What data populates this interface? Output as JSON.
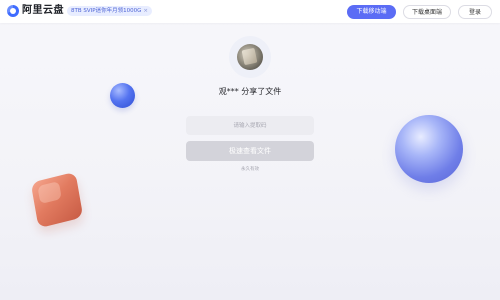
{
  "header": {
    "brand": "阿里云盘",
    "promo": "8TB SVIP迷你年月领1000G",
    "promo_close": "×",
    "download_mobile": "下载移动端",
    "download_desktop": "下载桌面端",
    "login": "登录"
  },
  "share": {
    "title": "观*** 分享了文件",
    "code_placeholder": "请输入提取码",
    "view_button": "极速查看文件",
    "expiry": "永久有效"
  },
  "colors": {
    "accent": "#5b6cf5",
    "disabled_button": "#d3d3da"
  }
}
